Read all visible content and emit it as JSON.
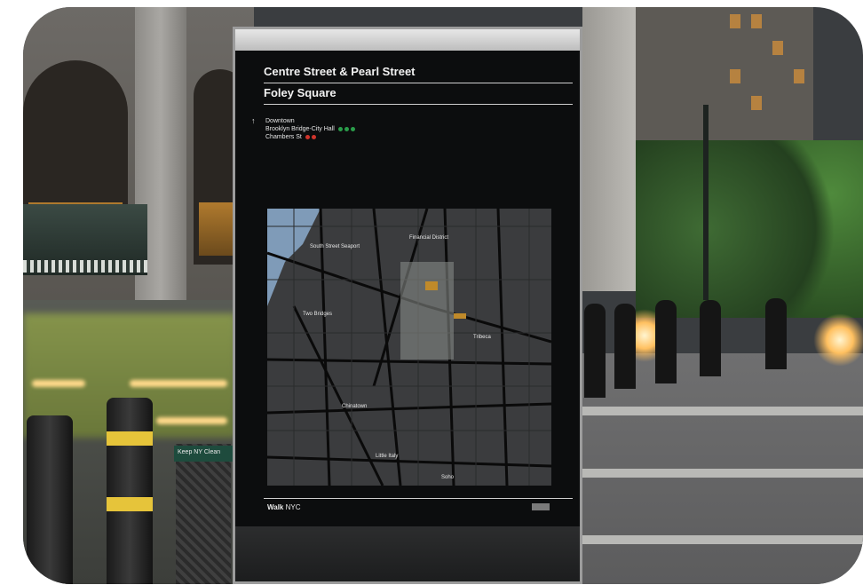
{
  "sign": {
    "location_title": "Centre Street & Pearl Street",
    "area_name": "Foley Square",
    "directions": {
      "arrow": "↑",
      "lines": [
        "Downtown",
        "Brooklyn Bridge-City Hall",
        "Chambers St"
      ],
      "line_dot_colors": [
        [],
        [
          "#2a9d4a",
          "#2a9d4a",
          "#2a9d4a"
        ],
        [
          "#d0342c",
          "#d0342c"
        ]
      ]
    },
    "map_labels": [
      "South Street Seaport",
      "Financial District",
      "Two Bridges",
      "Tribeca",
      "Chinatown",
      "Little Italy",
      "Soho"
    ],
    "footer_brand": "Walk",
    "footer_city": "NYC"
  },
  "trash_can_label": "Keep NY Clean",
  "colors": {
    "sign_panel": "#0c0d0e",
    "map_water": "#7f9bb8",
    "map_land": "#3b3c3e",
    "taxi": "#8a9a4a",
    "bollard_band": "#e6c43a"
  },
  "icons": [
    "arrow-up-icon",
    "subway-dot-icon",
    "no-littering-icon"
  ]
}
